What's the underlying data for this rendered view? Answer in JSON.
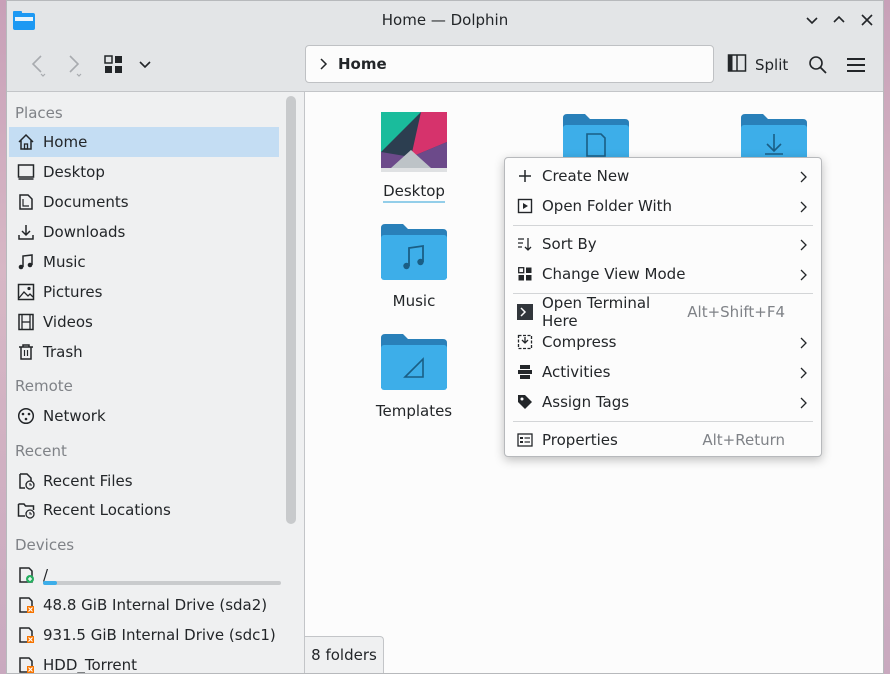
{
  "window": {
    "title": "Home — Dolphin",
    "icons": [
      "folder-app-icon",
      "minimize-icon",
      "maximize-icon",
      "close-icon"
    ]
  },
  "toolbar": {
    "location": "Home",
    "split_label": "Split"
  },
  "sidebar": {
    "places_header": "Places",
    "places": [
      {
        "label": "Home",
        "icon": "home-icon",
        "selected": true
      },
      {
        "label": "Desktop",
        "icon": "desktop-icon"
      },
      {
        "label": "Documents",
        "icon": "documents-icon"
      },
      {
        "label": "Downloads",
        "icon": "downloads-icon"
      },
      {
        "label": "Music",
        "icon": "music-icon"
      },
      {
        "label": "Pictures",
        "icon": "pictures-icon"
      },
      {
        "label": "Videos",
        "icon": "videos-icon"
      },
      {
        "label": "Trash",
        "icon": "trash-icon"
      }
    ],
    "remote_header": "Remote",
    "remote": [
      {
        "label": "Network",
        "icon": "network-icon"
      }
    ],
    "recent_header": "Recent",
    "recent": [
      {
        "label": "Recent Files",
        "icon": "recent-files-icon"
      },
      {
        "label": "Recent Locations",
        "icon": "recent-locations-icon"
      }
    ],
    "devices_header": "Devices",
    "devices": [
      {
        "label": "/",
        "icon": "drive-root-icon",
        "usage": 0.06
      },
      {
        "label": "48.8 GiB Internal Drive (sda2)",
        "icon": "drive-icon"
      },
      {
        "label": "931.5 GiB Internal Drive (sdc1)",
        "icon": "drive-icon"
      },
      {
        "label": "HDD_Torrent",
        "icon": "drive-icon"
      }
    ]
  },
  "content": {
    "items": [
      {
        "label": "Desktop"
      },
      {
        "label": "Music"
      },
      {
        "label": "Templates"
      }
    ],
    "status": "8 folders"
  },
  "context_menu": {
    "items": [
      {
        "label": "Create New",
        "shortcut": ""
      },
      {
        "label": "Open Folder With",
        "shortcut": ""
      },
      {
        "label": "Sort By",
        "shortcut": ""
      },
      {
        "label": "Change View Mode",
        "shortcut": ""
      },
      {
        "label": "Open Terminal Here",
        "shortcut": "Alt+Shift+F4"
      },
      {
        "label": "Compress",
        "shortcut": ""
      },
      {
        "label": "Activities",
        "shortcut": ""
      },
      {
        "label": "Assign Tags",
        "shortcut": ""
      },
      {
        "label": "Properties",
        "shortcut": "Alt+Return"
      }
    ]
  },
  "colors": {
    "accent": "#3daee9",
    "selection": "#c4ddf3",
    "folder": "#3daee9",
    "folder_dark": "#2980b9"
  }
}
